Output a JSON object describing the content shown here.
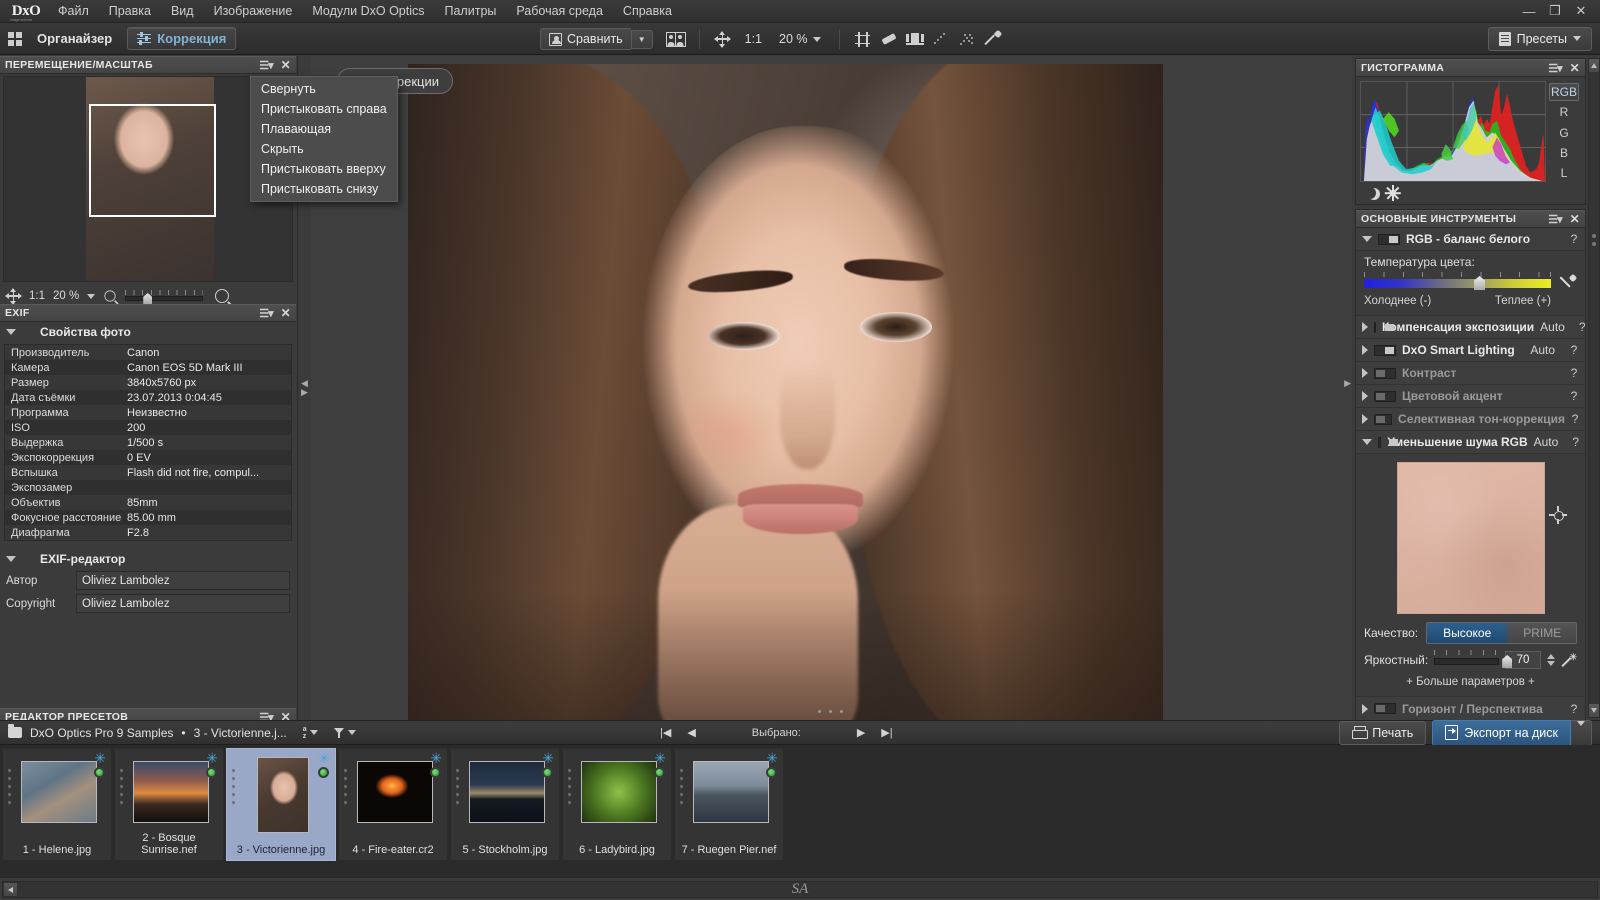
{
  "app": {
    "logo": "DxO",
    "logo_sub": "image science"
  },
  "menubar": {
    "items": [
      "Файл",
      "Правка",
      "Вид",
      "Изображение",
      "Модули DxO Optics",
      "Палитры",
      "Рабочая среда",
      "Справка"
    ],
    "window_controls": {
      "minimize": "—",
      "restore": "❐",
      "close": "✕"
    }
  },
  "toolbar": {
    "organizer_label": "Органайзер",
    "correction_label": "Коррекция",
    "compare_label": "Сравнить",
    "ratio_label": "1:1",
    "zoom_value": "20 %",
    "presets_label": "Пресеты",
    "icons": [
      "crop-icon",
      "eraser-icon",
      "horizon-icon",
      "dust-icon",
      "dust-cluster-icon",
      "pipette-icon"
    ]
  },
  "left_panel": {
    "navigator": {
      "title": "ПЕРЕМЕЩЕНИЕ/МАСШТАБ",
      "ratio_label": "1:1",
      "zoom_value": "20 %"
    },
    "exif": {
      "title": "EXIF",
      "section_title": "Свойства фото",
      "rows": [
        {
          "key": "Производитель",
          "value": "Canon"
        },
        {
          "key": "Камера",
          "value": "Canon EOS 5D Mark III"
        },
        {
          "key": "Размер",
          "value": "3840x5760 px"
        },
        {
          "key": "Дата съёмки",
          "value": "23.07.2013 0:04:45"
        },
        {
          "key": "Программа",
          "value": "Неизвестно"
        },
        {
          "key": "ISO",
          "value": "200"
        },
        {
          "key": "Выдержка",
          "value": "1/500 s"
        },
        {
          "key": "Экспокоррекция",
          "value": "0 EV"
        },
        {
          "key": "Вспышка",
          "value": "Flash did not fire, compul..."
        },
        {
          "key": "Экспозамер",
          "value": ""
        },
        {
          "key": "Объектив",
          "value": "85mm"
        },
        {
          "key": "Фокусное расстояние",
          "value": "85.00 mm"
        },
        {
          "key": "Диафрагма",
          "value": "F2.8"
        }
      ],
      "editor_title": "EXIF-редактор",
      "author_label": "Автор",
      "author_value": "Oliviez Lambolez",
      "copyright_label": "Copyright",
      "copyright_value": "Oliviez Lambolez"
    },
    "presets_editor": {
      "title": "РЕДАКТОР ПРЕСЕТОВ"
    }
  },
  "context_menu": {
    "items": [
      "Свернуть",
      "Пристыковать справа",
      "Плавающая",
      "Скрыть",
      "Пристыковать вверху",
      "Пристыковать снизу"
    ]
  },
  "viewer": {
    "hidden_button_label": "рекции"
  },
  "right_panel": {
    "histogram": {
      "title": "ГИСТОГРАММА",
      "channels": [
        "RGB",
        "R",
        "G",
        "B",
        "L"
      ],
      "selected_channel": "RGB"
    },
    "tools": {
      "title": "ОСНОВНЫЕ ИНСТРУМЕНТЫ",
      "white_balance": {
        "name": "RGB - баланс белого",
        "temp_label": "Температура цвета:",
        "cooler_label": "Холоднее (-)",
        "warmer_label": "Теплее (+)",
        "help": "?"
      },
      "rows": [
        {
          "name": "Компенсация экспозиции",
          "auto": "Auto",
          "help": "?",
          "enabled": true
        },
        {
          "name": "DxO Smart Lighting",
          "auto": "Auto",
          "help": "?",
          "enabled": true
        },
        {
          "name": "Контраст",
          "auto": "",
          "help": "?",
          "enabled": false
        },
        {
          "name": "Цветовой акцент",
          "auto": "",
          "help": "?",
          "enabled": false
        },
        {
          "name": "Селективная тон-коррекция",
          "auto": "",
          "help": "?",
          "enabled": false
        }
      ],
      "noise": {
        "name": "Уменьшение шума RGB",
        "auto": "Auto",
        "help": "?",
        "quality_label": "Качество:",
        "quality_high": "Высокое",
        "quality_prime": "PRIME",
        "luminance_label": "Яркостный:",
        "luminance_value": "70",
        "more_params": "+ Больше параметров +"
      },
      "horizon": {
        "name": "Горизонт / Перспектива",
        "help": "?",
        "enabled": false
      }
    }
  },
  "statusbar": {
    "folder": "DxO Optics Pro 9 Samples",
    "separator": "•",
    "file": "3 - Victorienne.j...",
    "selected_label": "Выбрано:",
    "print_label": "Печать",
    "export_label": "Экспорт на диск"
  },
  "filmstrip": {
    "items": [
      {
        "caption": "1 - Helene.jpg",
        "kind": "landscape",
        "selected": false
      },
      {
        "caption": "2 - Bosque Sunrise.nef",
        "kind": "landscape",
        "selected": false
      },
      {
        "caption": "3 - Victorienne.jpg",
        "kind": "portrait",
        "selected": true
      },
      {
        "caption": "4 - Fire-eater.cr2",
        "kind": "landscape",
        "selected": false
      },
      {
        "caption": "5 - Stockholm.jpg",
        "kind": "landscape",
        "selected": false
      },
      {
        "caption": "6 - Ladybird.jpg",
        "kind": "landscape",
        "selected": false
      },
      {
        "caption": "7 - Ruegen Pier.nef",
        "kind": "landscape",
        "selected": false
      }
    ]
  },
  "watermark": "SA",
  "colors": {
    "accent_blue": "#2c5480",
    "panel_bg": "#3b3b3b",
    "header_bg": "#4a4a4a",
    "selection": "#9aa8c8",
    "text": "#e2e2e2"
  }
}
